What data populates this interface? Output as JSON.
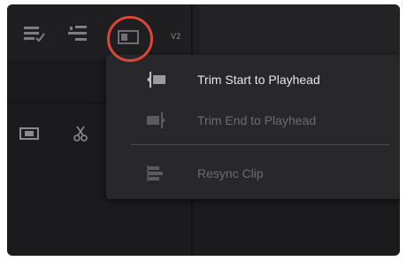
{
  "toolbar": {
    "track_label": "V2",
    "icons": [
      "clip-list-icon",
      "track-settings-icon",
      "trim-clip-icon"
    ]
  },
  "left_toolbar": {
    "icons": [
      "film-frame-icon",
      "scissors-icon"
    ]
  },
  "menu": {
    "items": [
      {
        "label": "Trim Start to Playhead",
        "icon": "trim-start-icon",
        "state": "enabled"
      },
      {
        "label": "Trim End to Playhead",
        "icon": "trim-end-icon",
        "state": "disabled"
      },
      {
        "label": "Resync Clip",
        "icon": "resync-clip-icon",
        "state": "disabled"
      }
    ]
  },
  "colors": {
    "highlight_ring": "#d9473a",
    "menu_background": "#28282b",
    "app_background": "#1b1b1e"
  }
}
